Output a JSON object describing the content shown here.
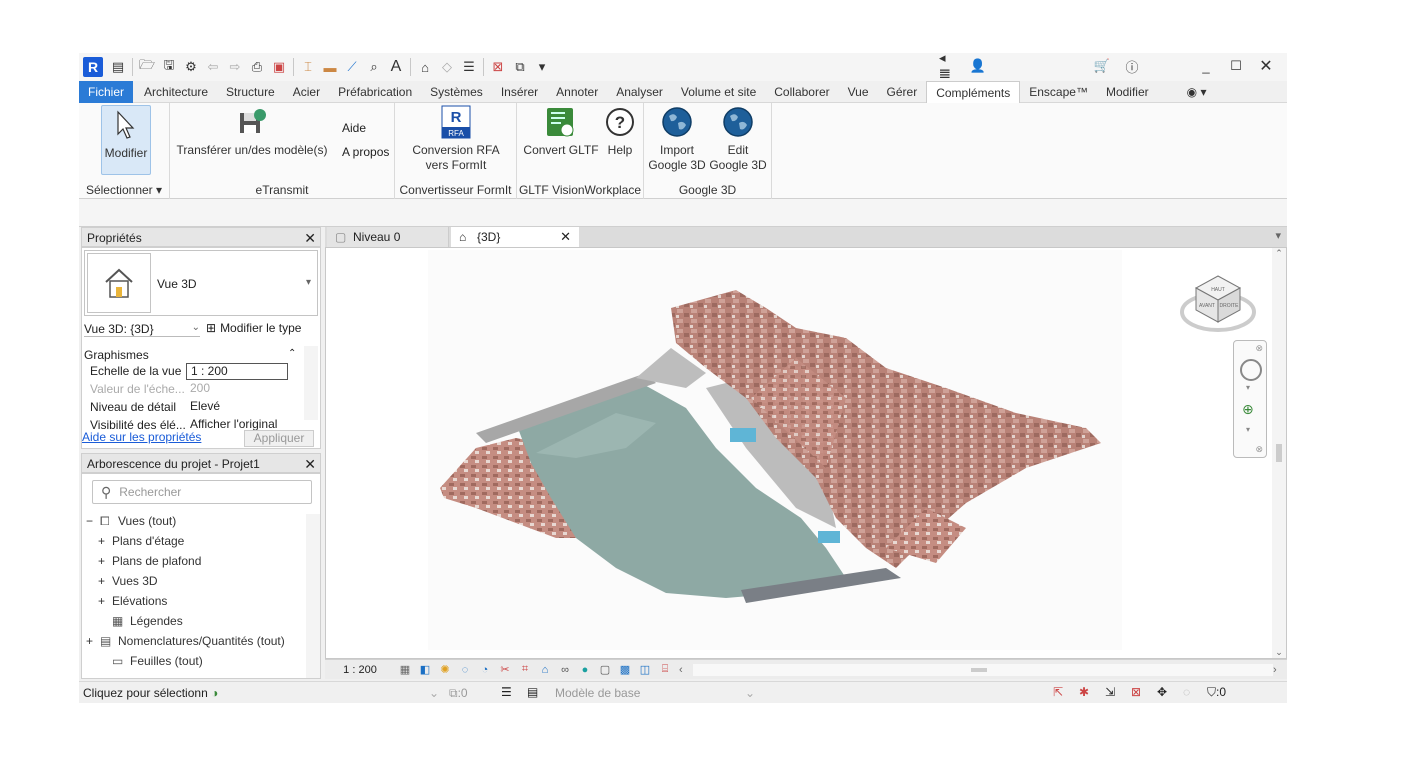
{
  "qat": {
    "logo": "R"
  },
  "menu": {
    "tabs": [
      "Fichier",
      "Architecture",
      "Structure",
      "Acier",
      "Préfabrication",
      "Systèmes",
      "Insérer",
      "Annoter",
      "Analyser",
      "Volume et site",
      "Collaborer",
      "Vue",
      "Gérer",
      "Compléments",
      "Enscape™",
      "Modifier"
    ],
    "active": "Compléments"
  },
  "ribbon": {
    "modifier": "Modifier",
    "selectionner": "Sélectionner",
    "transferer": "Transférer un/des modèle(s)",
    "aide": "Aide",
    "apropos": "A propos",
    "etransmit": "eTransmit",
    "conversion_l1": "Conversion RFA",
    "conversion_l2": "vers FormIt",
    "rfa_badge": "RFA",
    "convertisseur": "Convertisseur FormIt",
    "convert_gltf": "Convert GLTF",
    "help": "Help",
    "gltf_panel": "GLTF VisionWorkplace",
    "import_l1": "Import",
    "import_l2": "Google 3D",
    "edit_l1": "Edit",
    "edit_l2": "Google 3D",
    "google_panel": "Google 3D"
  },
  "properties": {
    "title": "Propriétés",
    "type_name": "Vue 3D",
    "view_selector": "Vue 3D: {3D}",
    "edit_type": "Modifier le type",
    "group": "Graphismes",
    "rows": [
      {
        "label": "Echelle de la vue",
        "value": "1 : 200"
      },
      {
        "label": "Valeur de l'éche...",
        "value": "200"
      },
      {
        "label": "Niveau de détail",
        "value": "Elevé"
      },
      {
        "label": "Visibilité des élé...",
        "value": "Afficher l'original"
      }
    ],
    "help_link": "Aide sur les propriétés",
    "apply": "Appliquer"
  },
  "browser": {
    "title": "Arborescence du projet - Projet1",
    "search_placeholder": "Rechercher",
    "items": [
      "Vues (tout)",
      "Plans d'étage",
      "Plans de plafond",
      "Vues 3D",
      "Elévations",
      "Légendes",
      "Nomenclatures/Quantités (tout)",
      "Feuilles (tout)"
    ]
  },
  "viewtabs": {
    "tab1": "Niveau 0",
    "tab2": "{3D}"
  },
  "viewcube": {
    "face1": "HAUT",
    "face2": "AVANT",
    "face3": "DROITE"
  },
  "viewbar": {
    "scale": "1 : 200"
  },
  "status": {
    "text": "Cliquez pour sélectionn",
    "count": ":0",
    "model": "Modèle de base",
    "filter": ":0"
  },
  "colors": {
    "accent": "#2b7bd6",
    "water": "#8fa8a3",
    "roof": "#b87a6e"
  }
}
